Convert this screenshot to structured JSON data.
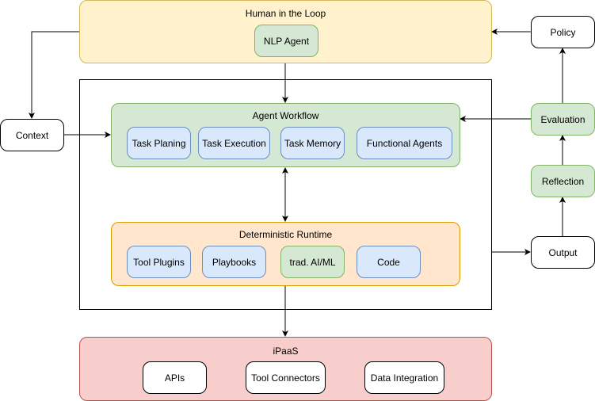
{
  "groups": {
    "human_in_loop": {
      "title": "Human in the Loop",
      "nodes": [
        "NLP Agent"
      ]
    },
    "agent_workflow": {
      "title": "Agent Workflow",
      "nodes": [
        "Task Planing",
        "Task Execution",
        "Task Memory",
        "Functional Agents"
      ]
    },
    "deterministic_runtime": {
      "title": "Deterministic Runtime",
      "nodes": [
        "Tool Plugins",
        "Playbooks",
        "trad. AI/ML",
        "Code"
      ]
    },
    "ipaas": {
      "title": "iPaaS",
      "nodes": [
        "APIs",
        "Tool Connectors",
        "Data Integration"
      ]
    }
  },
  "side_nodes": {
    "context": "Context",
    "policy": "Policy",
    "evaluation": "Evaluation",
    "reflection": "Reflection",
    "output": "Output"
  },
  "colors": {
    "yellow_fill": "#fff2cc",
    "yellow_stroke": "#d6b656",
    "green_fill": "#d5e8d4",
    "green_stroke": "#82b366",
    "orange_fill": "#ffe6cc",
    "orange_stroke": "#d79b00",
    "red_fill": "#f8cecc",
    "red_stroke": "#b85450",
    "blue_fill": "#dae8fc",
    "blue_stroke": "#6c8ebf"
  },
  "edges": [
    {
      "from": "NLP Agent",
      "to": "Agent Workflow"
    },
    {
      "from": "Human in the Loop",
      "to": "Context"
    },
    {
      "from": "Context",
      "to": "Agent Workflow"
    },
    {
      "from": "Agent Workflow",
      "to": "Deterministic Runtime",
      "bidirectional": true
    },
    {
      "from": "Deterministic Runtime",
      "to": "iPaaS"
    },
    {
      "from": "Deterministic Runtime",
      "to": "Output"
    },
    {
      "from": "Output",
      "to": "Reflection"
    },
    {
      "from": "Reflection",
      "to": "Evaluation"
    },
    {
      "from": "Evaluation",
      "to": "Policy"
    },
    {
      "from": "Evaluation",
      "to": "Agent Workflow"
    },
    {
      "from": "Policy",
      "to": "Human in the Loop"
    }
  ]
}
